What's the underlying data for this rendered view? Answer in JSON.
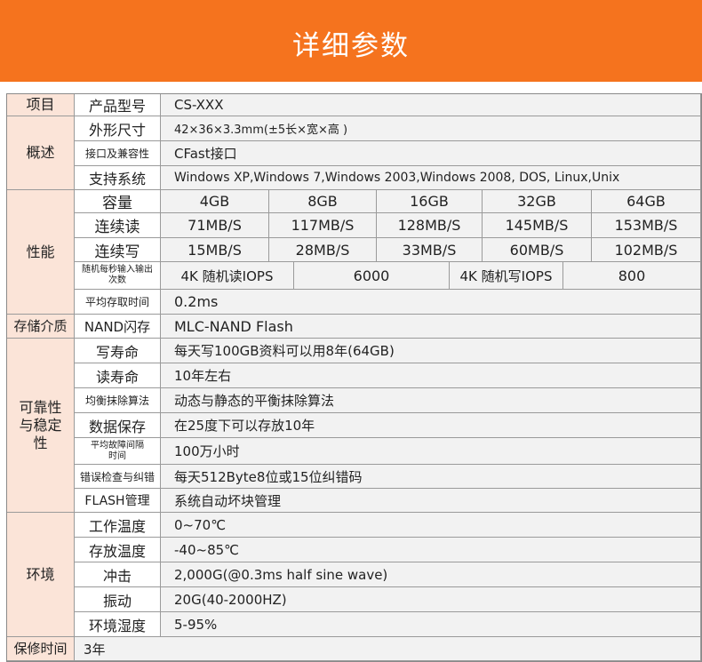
{
  "header": {
    "title": "详细参数"
  },
  "rows": {
    "item": {
      "category": "项目",
      "label": "产品型号",
      "value": "CS-XXX"
    },
    "overview": {
      "category": "概述",
      "size_label": "外形尺寸",
      "size_value": "42×36×3.3mm(±5长×宽×高 )",
      "iface_label": "接口及兼容性",
      "iface_value": "CFast接口",
      "os_label": "支持系统",
      "os_value": "Windows XP,Windows 7,Windows 2003,Windows 2008,  DOS,  Linux,Unix"
    },
    "performance": {
      "category": "性能",
      "capacity_label": "容量",
      "capacities": [
        "4GB",
        "8GB",
        "16GB",
        "32GB",
        "64GB"
      ],
      "read_label": "连续读",
      "reads": [
        "71MB/S",
        "117MB/S",
        "128MB/S",
        "145MB/S",
        "153MB/S"
      ],
      "write_label": "连续写",
      "writes": [
        "15MB/S",
        "28MB/S",
        "33MB/S",
        "60MB/S",
        "102MB/S"
      ],
      "iops_label": "随机每秒输入输出次数",
      "iops_read_label": "4K 随机读IOPS",
      "iops_read_value": "6000",
      "iops_write_label": "4K 随机写IOPS",
      "iops_write_value": "800",
      "access_label": "平均存取时间",
      "access_value": "0.2ms"
    },
    "media": {
      "category": "存储介质",
      "label": "NAND闪存",
      "value": "MLC-NAND Flash"
    },
    "reliability": {
      "category": "可靠性与稳定性",
      "write_life_label": "写寿命",
      "write_life_value": "每天写100GB资料可以用8年(64GB)",
      "read_life_label": "读寿命",
      "read_life_value": "10年左右",
      "wear_label": "均衡抹除算法",
      "wear_value": "动态与静态的平衡抹除算法",
      "retention_label": "数据保存",
      "retention_value": "在25度下可以存放10年",
      "mtbf_label": "平均故障间隔时间",
      "mtbf_value": "100万小时",
      "ecc_label": "错误检查与纠错",
      "ecc_value": "每天512Byte8位或15位纠错码",
      "flash_label": "FLASH管理",
      "flash_value": "系统自动坏块管理"
    },
    "environment": {
      "category": "环境",
      "work_temp_label": "工作温度",
      "work_temp_value": "0~70℃",
      "store_temp_label": "存放温度",
      "store_temp_value": "-40~85℃",
      "shock_label": "冲击",
      "shock_value": "2,000G(@0.3ms half sine wave)",
      "vibration_label": "振动",
      "vibration_value": "20G(40-2000HZ)",
      "humidity_label": "环境湿度",
      "humidity_value": "5-95%"
    },
    "warranty": {
      "category": "保修时间",
      "value": "3年"
    }
  }
}
